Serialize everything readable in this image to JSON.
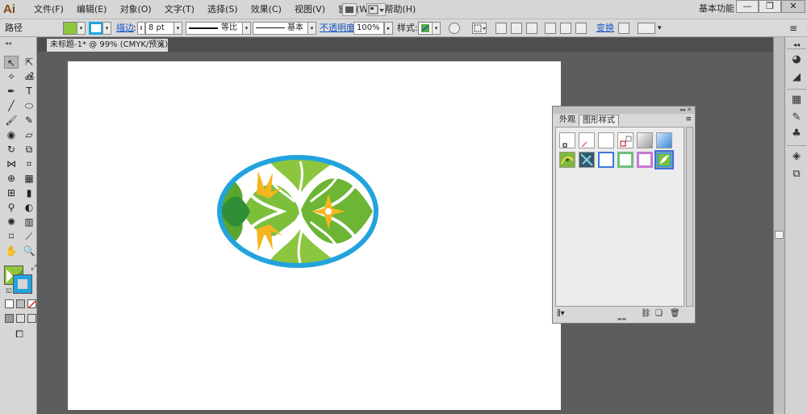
{
  "app": {
    "logo": "Ai",
    "workspace_label": "基本功能"
  },
  "menu": [
    "文件(F)",
    "编辑(E)",
    "对象(O)",
    "文字(T)",
    "选择(S)",
    "效果(C)",
    "视图(V)",
    "窗口(W)",
    "帮助(H)"
  ],
  "window_controls": {
    "minimize": "—",
    "restore": "❐",
    "close": "✕",
    "workspace_arrow": "▾"
  },
  "control_bar": {
    "object_label": "路径",
    "stroke_label": "描边",
    "stroke_weight": "8 pt",
    "profile_label": "等比",
    "brush_label": "基本",
    "opacity_label": "不透明度",
    "opacity_value": "100%",
    "style_label": "样式",
    "transform_label": "变换"
  },
  "document": {
    "tab_title": "未标题-1* @ 99% (CMYK/预览)",
    "close": "×"
  },
  "panel": {
    "tabs": [
      "外观",
      "图形样式"
    ],
    "active_tab": "图形样式",
    "collapse": "◂◂ ✕",
    "menu_icon": "≡"
  },
  "colors": {
    "fill": "#8fc63f",
    "stroke": "#23a3dd",
    "arrow": "#ff2222",
    "selection_outline": "#3b6fd8"
  },
  "icons": {
    "selection": "selection-tool-icon",
    "direct": "direct-selection-icon",
    "pen": "pen-tool-icon",
    "type": "type-tool-icon",
    "hand": "hand-tool-icon",
    "zoom": "zoom-tool-icon"
  }
}
